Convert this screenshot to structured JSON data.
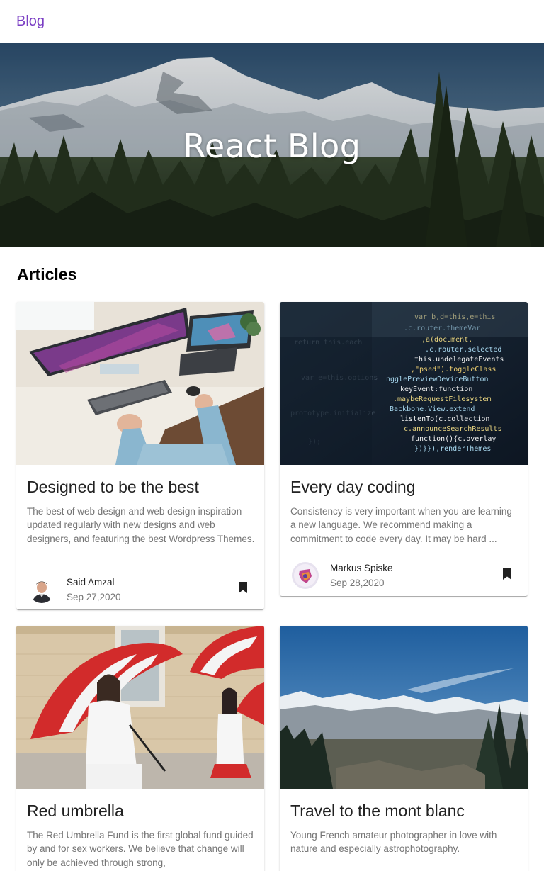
{
  "appbar": {
    "brand": "Blog"
  },
  "hero": {
    "title": "React Blog"
  },
  "articles": {
    "heading": "Articles",
    "items": [
      {
        "title": "Designed to be the best",
        "excerpt": "The best of web design and web design inspiration updated regularly with new designs and web designers, and featuring the best Wordpress Themes.",
        "author": "Said Amzal",
        "date": "Sep 27,2020",
        "image": "desk-workspace-photo",
        "avatar": "said-amzal-avatar"
      },
      {
        "title": "Every day coding",
        "excerpt": "Consistency is very important when you are learning a new language. We recommend making a commitment to code every day. It may be hard ...",
        "author": "Markus Spiske",
        "date": "Sep 28,2020",
        "image": "code-screen-photo",
        "avatar": "markus-spiske-avatar"
      },
      {
        "title": "Red umbrella",
        "excerpt": "The Red Umbrella Fund is the first global fund guided by and for sex workers. We believe that change will only be achieved through strong,",
        "image": "red-umbrella-photo"
      },
      {
        "title": "Travel to the mont blanc",
        "excerpt": "Young French amateur photographer in love with nature and especially astrophotography.",
        "image": "mont-blanc-photo"
      }
    ]
  },
  "colors": {
    "brand": "#7b3fc4",
    "title": "#222222",
    "muted": "#757575",
    "bookmark": "#212121"
  }
}
